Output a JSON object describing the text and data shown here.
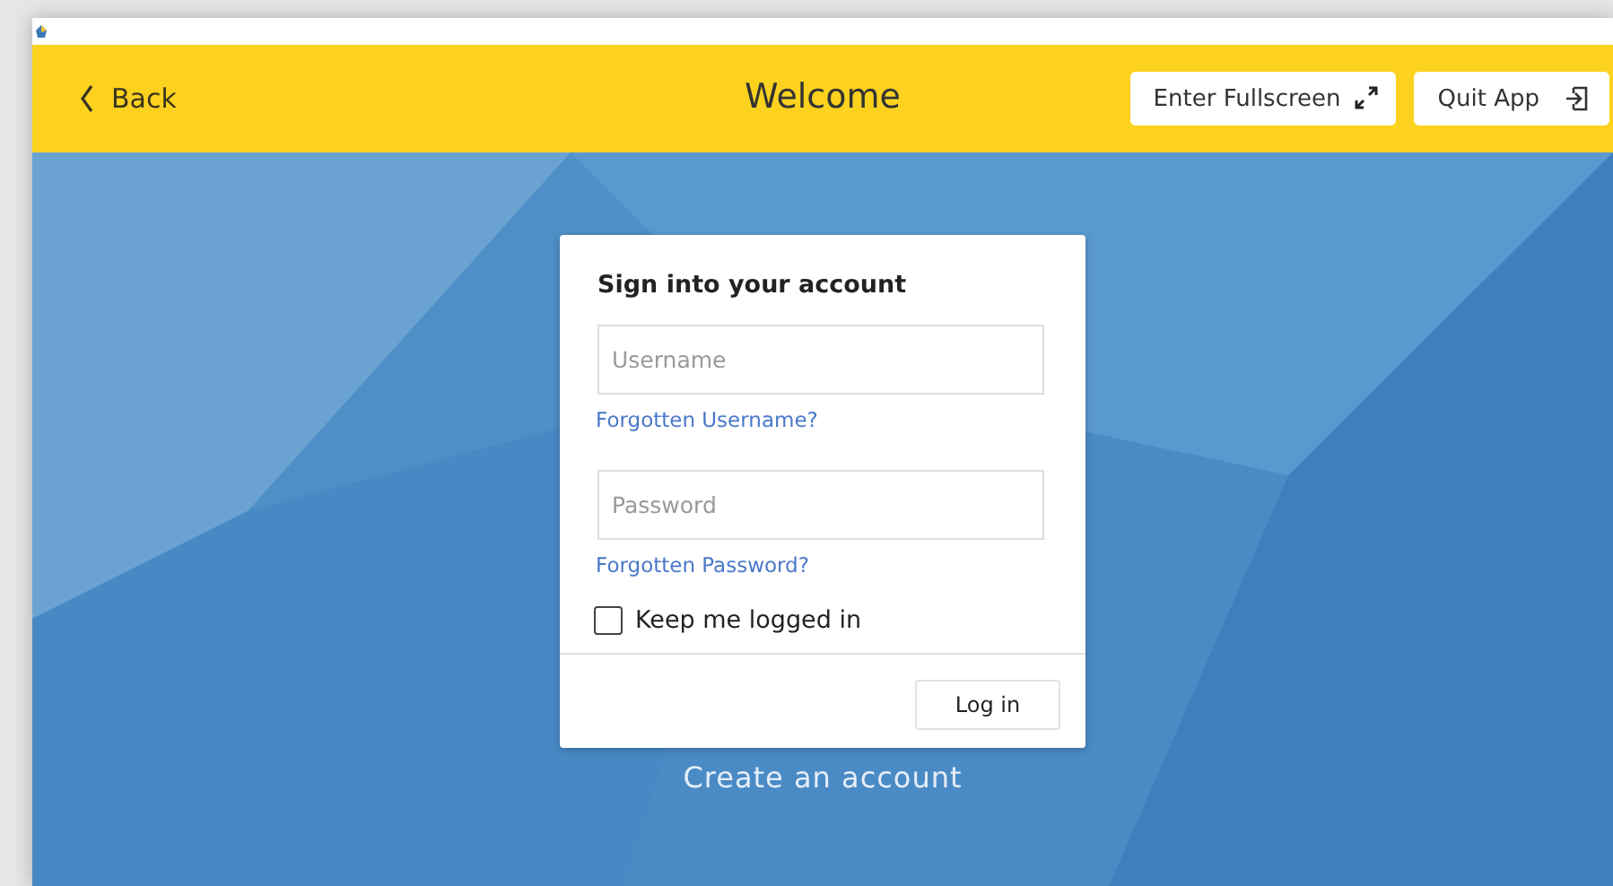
{
  "header": {
    "back": "Back",
    "title": "Welcome",
    "buttons": [
      {
        "label": "Enter Fullscreen",
        "kind": "fullscreen"
      },
      {
        "label": "Quit App",
        "kind": "quit"
      }
    ]
  },
  "login": {
    "heading": "Sign into your account",
    "username": {
      "placeholder": "Username"
    },
    "forgot_username": "Forgotten Username?",
    "password": {
      "placeholder": "Password"
    },
    "forgot_password": "Forgotten Password?",
    "keep_logged_in": {
      "label": "Keep me logged in",
      "checked": false
    },
    "submit": "Log in"
  },
  "create_account": "Create an account"
}
